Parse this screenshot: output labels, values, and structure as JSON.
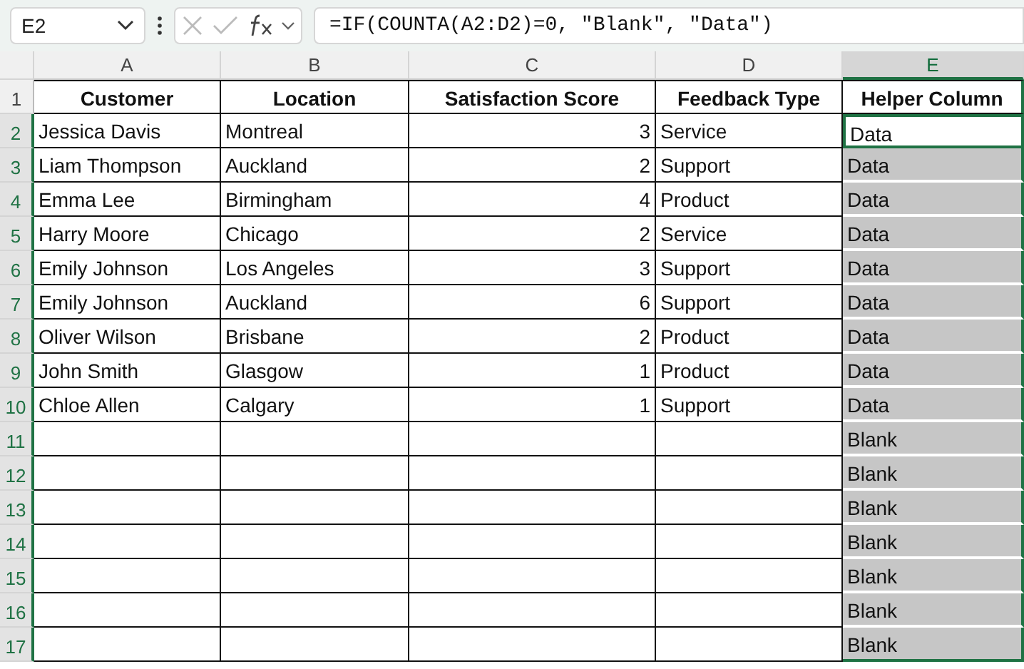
{
  "name_box": {
    "value": "E2"
  },
  "formula_bar": {
    "formula": "=IF(COUNTA(A2:D2)=0, \"Blank\", \"Data\")"
  },
  "column_headers": [
    {
      "label": "A",
      "selected": false
    },
    {
      "label": "B",
      "selected": false
    },
    {
      "label": "C",
      "selected": false
    },
    {
      "label": "D",
      "selected": false
    },
    {
      "label": "E",
      "selected": true
    }
  ],
  "header_row": {
    "number": "1",
    "selected": false,
    "labels": [
      "Customer",
      "Location",
      "Satisfaction Score",
      "Feedback Type",
      "Helper Column"
    ]
  },
  "rows": [
    {
      "number": "2",
      "selected": true,
      "customer": "Jessica Davis",
      "location": "Montreal",
      "score": "3",
      "feedback_type": "Service",
      "helper": "Data",
      "helper_selected": true,
      "helper_active": true
    },
    {
      "number": "3",
      "selected": true,
      "customer": "Liam Thompson",
      "location": "Auckland",
      "score": "2",
      "feedback_type": "Support",
      "helper": "Data",
      "helper_selected": true,
      "helper_active": false
    },
    {
      "number": "4",
      "selected": true,
      "customer": "Emma Lee",
      "location": "Birmingham",
      "score": "4",
      "feedback_type": "Product",
      "helper": "Data",
      "helper_selected": true,
      "helper_active": false
    },
    {
      "number": "5",
      "selected": true,
      "customer": "Harry Moore",
      "location": "Chicago",
      "score": "2",
      "feedback_type": "Service",
      "helper": "Data",
      "helper_selected": true,
      "helper_active": false
    },
    {
      "number": "6",
      "selected": true,
      "customer": "Emily Johnson",
      "location": "Los Angeles",
      "score": "3",
      "feedback_type": "Support",
      "helper": "Data",
      "helper_selected": true,
      "helper_active": false
    },
    {
      "number": "7",
      "selected": true,
      "customer": "Emily Johnson",
      "location": "Auckland",
      "score": "6",
      "feedback_type": "Support",
      "helper": "Data",
      "helper_selected": true,
      "helper_active": false
    },
    {
      "number": "8",
      "selected": true,
      "customer": "Oliver Wilson",
      "location": "Brisbane",
      "score": "2",
      "feedback_type": "Product",
      "helper": "Data",
      "helper_selected": true,
      "helper_active": false
    },
    {
      "number": "9",
      "selected": true,
      "customer": "John Smith",
      "location": "Glasgow",
      "score": "1",
      "feedback_type": "Product",
      "helper": "Data",
      "helper_selected": true,
      "helper_active": false
    },
    {
      "number": "10",
      "selected": true,
      "customer": "Chloe Allen",
      "location": "Calgary",
      "score": "1",
      "feedback_type": "Support",
      "helper": "Data",
      "helper_selected": true,
      "helper_active": false
    },
    {
      "number": "11",
      "selected": true,
      "helper": "Blank",
      "helper_selected": true,
      "helper_active": false
    },
    {
      "number": "12",
      "selected": true,
      "helper": "Blank",
      "helper_selected": true,
      "helper_active": false
    },
    {
      "number": "13",
      "selected": true,
      "helper": "Blank",
      "helper_selected": true,
      "helper_active": false
    },
    {
      "number": "14",
      "selected": true,
      "helper": "Blank",
      "helper_selected": true,
      "helper_active": false
    },
    {
      "number": "15",
      "selected": true,
      "helper": "Blank",
      "helper_selected": true,
      "helper_active": false
    },
    {
      "number": "16",
      "selected": true,
      "helper": "Blank",
      "helper_selected": true,
      "helper_active": false
    },
    {
      "number": "17",
      "selected": true,
      "helper": "Blank",
      "helper_selected": true,
      "helper_active": false
    }
  ]
}
